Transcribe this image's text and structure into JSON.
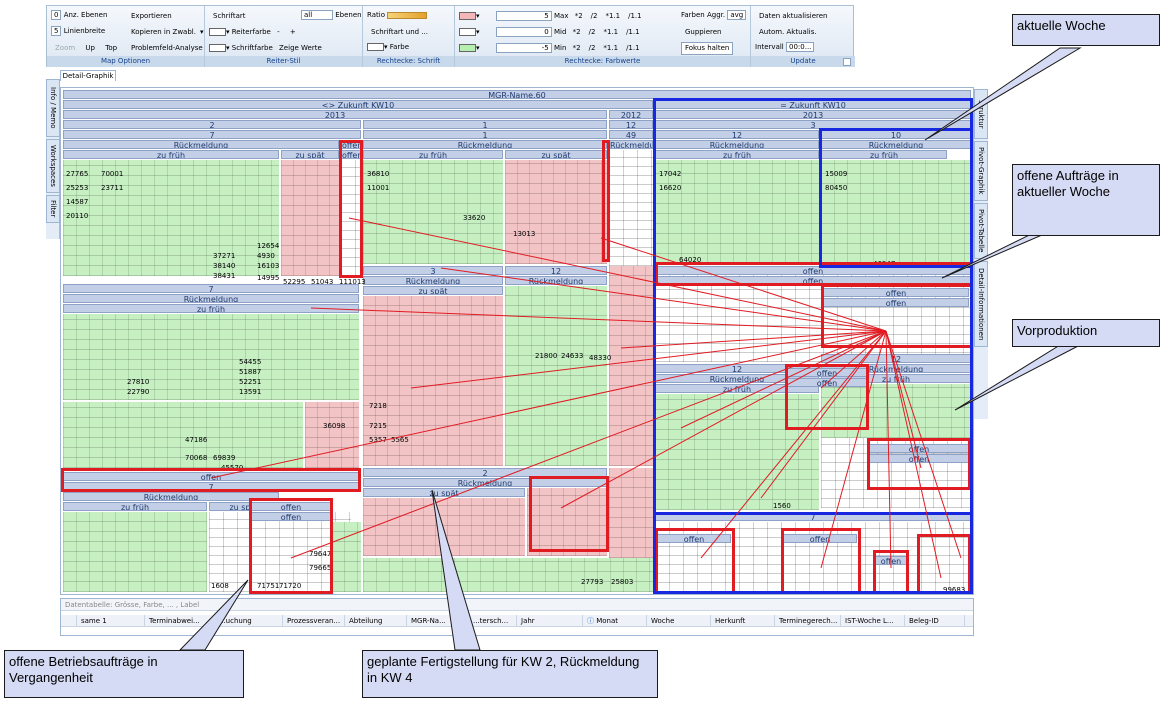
{
  "ribbon": {
    "map_optionen": {
      "caption": "Map Optionen",
      "ebenen_value": "0",
      "anz_ebenen": "Anz. Ebenen",
      "linien_value": "5",
      "linienbreite": "Linienbreite",
      "zoom": "Zoom",
      "up": "Up",
      "top": "Top",
      "exportieren": "Exportieren",
      "kopieren": "Kopieren in Zwabl.",
      "problemfeld": "Problemfeld-Analyse"
    },
    "reiter_stil": {
      "caption": "Reiter-Stil",
      "schriftart": "Schriftart",
      "all": "all",
      "ebenen": "Ebenen",
      "reiterfarbe": "Reiterfarbe",
      "minus": "-",
      "plus": "+",
      "schriftfarbe": "Schriftfarbe",
      "zeige_werte": "Zeige Werte"
    },
    "rechtecke_schrift": {
      "caption": "Rechtecke: Schrift",
      "ratio": "Ratio",
      "schriftart_und": "Schriftart und ...",
      "farbe": "Farbe"
    },
    "rechtecke_farbwerte": {
      "caption": "Rechtecke: Farbwerte",
      "max_value": "5",
      "max": "Max",
      "mid_value": "0",
      "mid": "Mid",
      "min_value": "-5",
      "min": "Min",
      "factors": [
        "*2",
        "/2",
        "*1.1",
        "/1.1"
      ],
      "farben_aggr": "Farben Aggr.",
      "avg": "avg",
      "gruppieren": "Guppieren",
      "fokus_halten": "Fokus halten",
      "colors": {
        "max": "#f4b6b8",
        "mid": "#ffffff",
        "min": "#b6efb0"
      }
    },
    "update": {
      "caption": "Update",
      "daten_aktualisieren": "Daten aktualisieren",
      "autom": "Autom. Aktualis.",
      "intervall": "Intervall",
      "intervall_value": "00:0..."
    }
  },
  "detail_tab": "Detail-Graphik",
  "left_tabs": [
    "Info / Memo",
    "Workspaces",
    "Filter"
  ],
  "right_tabs": [
    "Struktur",
    "Pivot-Graphik",
    "Pivot-Tabelle",
    "Detail-Informationen"
  ],
  "treemap": {
    "root": "MGR-Name.60",
    "zukunft_left": "<> Zukunft KW10",
    "zukunft_right": "= Zukunft KW10",
    "year_left": "2013",
    "year_mid": "2012",
    "year_right": "2013",
    "kw_labels": {
      "kw2": "2",
      "kw1": "1",
      "kw12a": "12",
      "kw3": "3",
      "kw7": "7",
      "kw49": "49",
      "kw12b": "12",
      "kw10": "10"
    },
    "rueckmeldung": "Rückmeldung",
    "zu_frueh": "zu früh",
    "zu_spaet": "zu spät",
    "offen": "offen",
    "sample_values": [
      "37271",
      "38140",
      "38431",
      "52295",
      "51043",
      "111013",
      "33620",
      "13013",
      "64020",
      "61869",
      "47933",
      "46947",
      "27810",
      "22790",
      "54455",
      "51887",
      "52251",
      "47186",
      "70068",
      "69839",
      "45570",
      "36098",
      "79647",
      "79665",
      "1608",
      "71751",
      "71720",
      "25803",
      "27793",
      "20701",
      "1560",
      "99683",
      "21800",
      "24633",
      "48330",
      "26000",
      "7218",
      "7215",
      "5357",
      "5565",
      "16103",
      "4930",
      "12654",
      "13591",
      "14995",
      "79186"
    ],
    "sample_small": [
      "27765",
      "25253",
      "14587",
      "20110",
      "70001",
      "23711",
      "36810",
      "11001",
      "17042",
      "16620",
      "15009",
      "80450"
    ]
  },
  "table": {
    "hint": "Datentabelle: Grösse, Farbe, ... , Label",
    "columns": [
      "same 1",
      "Terminabwei...",
      "...uchung",
      "Prozessveran...",
      "Abteilung",
      "MGR-Na...",
      "...tersch...",
      "Jahr",
      "Monat",
      "Woche",
      "Herkunft",
      "Terminegerech...",
      "IST-Woche L...",
      "Beleg-ID"
    ]
  },
  "callouts": {
    "aktuelle_woche": "aktuelle Woche",
    "offene_auftraege": "offene Aufträge in aktueller Woche",
    "vorproduktion": "Vorproduktion",
    "offene_betriebs": "offene Betriebsaufträge in Vergangenheit",
    "geplante": "geplante Fertigstellung für KW 2, Rückmeldung in KW 4"
  }
}
